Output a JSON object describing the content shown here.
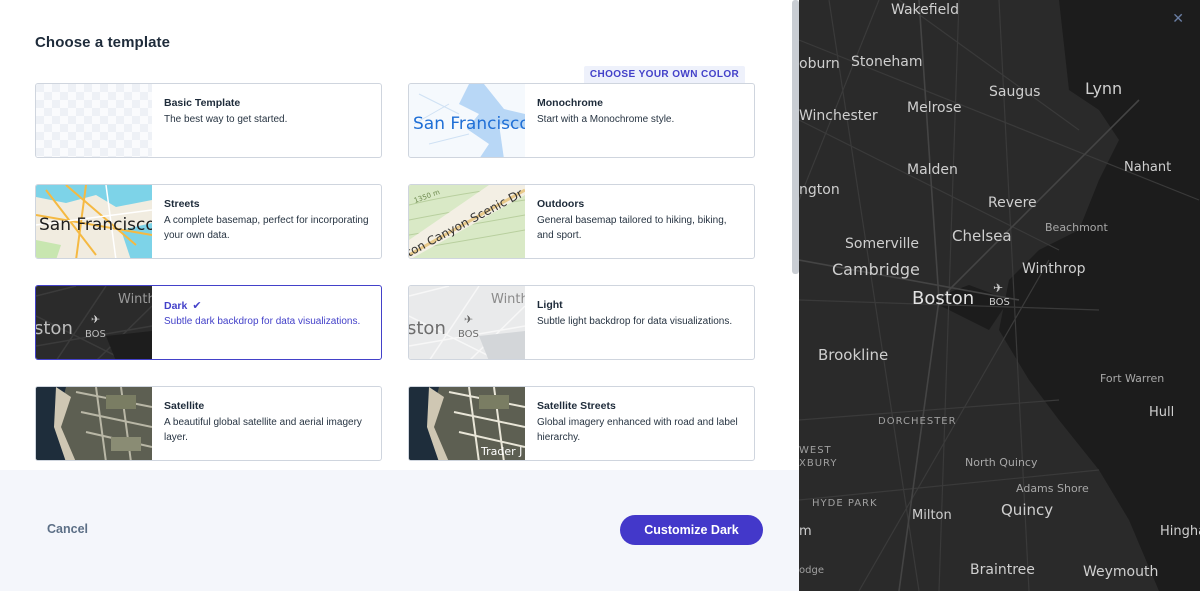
{
  "dialog": {
    "title": "Choose a template",
    "own_color_label": "CHOOSE YOUR OWN COLOR",
    "templates": [
      {
        "name": "Basic Template",
        "description": "The best way to get started.",
        "selected": false
      },
      {
        "name": "Monochrome",
        "description": "Start with a Monochrome style.",
        "selected": false,
        "thumb_text": "San Francisco"
      },
      {
        "name": "Streets",
        "description": "A complete basemap, perfect for incorporating your own data.",
        "selected": false,
        "thumb_text": "San Francisco"
      },
      {
        "name": "Outdoors",
        "description": "General basemap tailored to hiking, biking, and sport.",
        "selected": false,
        "thumb_text": "ton Canyon Scenic Dr",
        "thumb_text2": "1350 m"
      },
      {
        "name": "Dark",
        "description": "Subtle dark backdrop for data visualizations.",
        "selected": true,
        "thumb_text": "ston",
        "thumb_text2": "BOS",
        "thumb_text3": "Winth"
      },
      {
        "name": "Light",
        "description": "Subtle light backdrop for data visualizations.",
        "selected": false,
        "thumb_text": "ston",
        "thumb_text2": "BOS",
        "thumb_text3": "Winth"
      },
      {
        "name": "Satellite",
        "description": "A beautiful global satellite and aerial imagery layer.",
        "selected": false
      },
      {
        "name": "Satellite Streets",
        "description": "Global imagery enhanced with road and label hierarchy.",
        "selected": false,
        "thumb_text": "Trader J"
      }
    ],
    "cancel_label": "Cancel",
    "customize_label": "Customize Dark",
    "accent_color": "#4341c9"
  },
  "map": {
    "labels": [
      {
        "text": "Wakefield",
        "size": "large"
      },
      {
        "text": "Stoneham",
        "size": "large"
      },
      {
        "text": "oburn",
        "size": "large"
      },
      {
        "text": "Lynn",
        "size": "xlarge"
      },
      {
        "text": "Saugus",
        "size": "large"
      },
      {
        "text": "Melrose",
        "size": "large"
      },
      {
        "text": "Winchester",
        "size": "large"
      },
      {
        "text": "Nahant",
        "size": "large"
      },
      {
        "text": "Malden",
        "size": "large"
      },
      {
        "text": "ngton",
        "size": "large"
      },
      {
        "text": "Revere",
        "size": "large"
      },
      {
        "text": "Beachmont",
        "size": "small"
      },
      {
        "text": "Somerville",
        "size": "large"
      },
      {
        "text": "Chelsea",
        "size": "xlarge"
      },
      {
        "text": "Cambridge",
        "size": "xlarge"
      },
      {
        "text": "Winthrop",
        "size": "large"
      },
      {
        "text": "Boston",
        "size": "xxlarge"
      },
      {
        "text": "BOS",
        "size": "small"
      },
      {
        "text": "Brookline",
        "size": "xlarge"
      },
      {
        "text": "Fort Warren",
        "size": "small"
      },
      {
        "text": "Hull",
        "size": "large"
      },
      {
        "text": "DORCHESTER",
        "size": "small"
      },
      {
        "text": "WEST",
        "size": "small"
      },
      {
        "text": "XBURY",
        "size": "small"
      },
      {
        "text": "North Quincy",
        "size": "small"
      },
      {
        "text": "Adams Shore",
        "size": "small"
      },
      {
        "text": "HYDE PARK",
        "size": "small"
      },
      {
        "text": "Milton",
        "size": "large"
      },
      {
        "text": "Quincy",
        "size": "xlarge"
      },
      {
        "text": "Hingha",
        "size": "large"
      },
      {
        "text": "m",
        "size": "large"
      },
      {
        "text": "odge",
        "size": "small"
      },
      {
        "text": "Braintree",
        "size": "large"
      },
      {
        "text": "Weymouth",
        "size": "large"
      }
    ],
    "close_icon": "close-icon"
  }
}
